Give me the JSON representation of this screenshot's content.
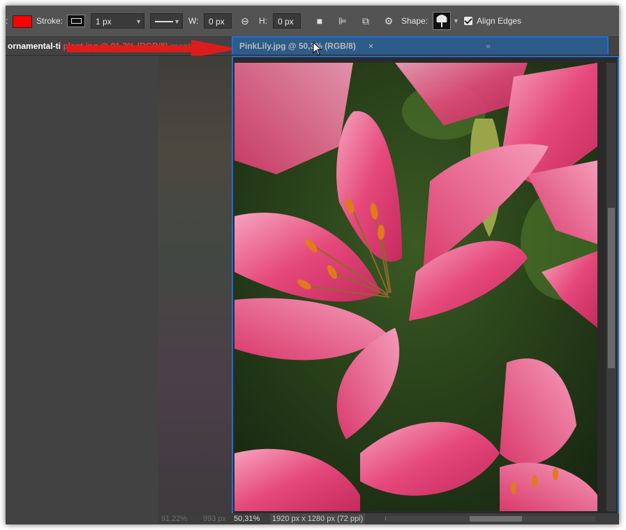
{
  "options_bar": {
    "colon": ":",
    "fill_color": "#ff0000",
    "stroke_label": "Stroke:",
    "stroke_width": "1 px",
    "w_label": "W:",
    "w_value": "0 px",
    "h_label": "H:",
    "h_value": "0 px",
    "shape_label": "Shape:",
    "align_edges_label": "Align Edges",
    "align_edges_checked": true
  },
  "tabs": {
    "tab1_white": "ornamental-ti",
    "tab1_red": " plant.jpg @ 91,2% (RGB/8)",
    "tab1_ghost": "mental-ti",
    "tab2_label": "PinkLily.jpg @ 50,3% (RGB/8)",
    "tab2_close": "×",
    "tab2_overflow": "»"
  },
  "status_bar": {
    "ghost_zoom": "91,22%",
    "ghost_size": "993 px",
    "zoom": "50,31%",
    "doc_size": "1920 px x 1280 px (72 ppi)",
    "nav_arrow": "›"
  },
  "colors": {
    "accent_blue": "#1f6fd6",
    "arrow_red": "#e8191a",
    "petal_pink": "#e5487a",
    "stamen_orange": "#e07a1c"
  }
}
